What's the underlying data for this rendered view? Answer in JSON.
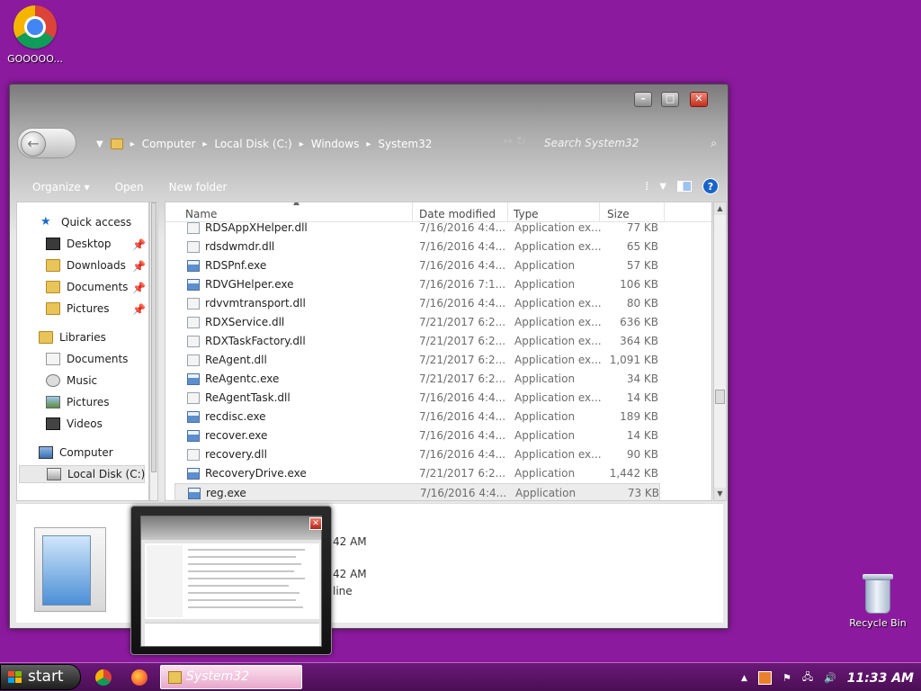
{
  "desktop": {
    "chrome_label": "GOOOOO...",
    "recycle_label": "Recycle Bin"
  },
  "window": {
    "breadcrumb": [
      "Computer",
      "Local Disk (C:)",
      "Windows",
      "System32"
    ],
    "search_placeholder": "Search System32",
    "toolbar": {
      "organize": "Organize",
      "open": "Open",
      "new_folder": "New folder"
    },
    "columns": {
      "name": "Name",
      "date": "Date modified",
      "type": "Type",
      "size": "Size"
    }
  },
  "nav": {
    "quick_access": "Quick access",
    "quick_items": [
      "Desktop",
      "Downloads",
      "Documents",
      "Pictures"
    ],
    "libraries": "Libraries",
    "library_items": [
      "Documents",
      "Music",
      "Pictures",
      "Videos"
    ],
    "computer": "Computer",
    "local_disk": "Local Disk (C:)"
  },
  "files": [
    {
      "name": "RDSAppXHelper.dll",
      "date": "7/16/2016 4:4...",
      "type": "Application ex...",
      "size": "77 KB",
      "kind": "dll"
    },
    {
      "name": "rdsdwmdr.dll",
      "date": "7/16/2016 4:4...",
      "type": "Application ex...",
      "size": "65 KB",
      "kind": "dll"
    },
    {
      "name": "RDSPnf.exe",
      "date": "7/16/2016 4:4...",
      "type": "Application",
      "size": "57 KB",
      "kind": "exe"
    },
    {
      "name": "RDVGHelper.exe",
      "date": "7/16/2016 7:1...",
      "type": "Application",
      "size": "106 KB",
      "kind": "exe"
    },
    {
      "name": "rdvvmtransport.dll",
      "date": "7/16/2016 4:4...",
      "type": "Application ex...",
      "size": "80 KB",
      "kind": "dll"
    },
    {
      "name": "RDXService.dll",
      "date": "7/21/2017 6:2...",
      "type": "Application ex...",
      "size": "636 KB",
      "kind": "dll"
    },
    {
      "name": "RDXTaskFactory.dll",
      "date": "7/21/2017 6:2...",
      "type": "Application ex...",
      "size": "364 KB",
      "kind": "dll"
    },
    {
      "name": "ReAgent.dll",
      "date": "7/21/2017 6:2...",
      "type": "Application ex...",
      "size": "1,091 KB",
      "kind": "dll"
    },
    {
      "name": "ReAgentc.exe",
      "date": "7/21/2017 6:2...",
      "type": "Application",
      "size": "34 KB",
      "kind": "exe"
    },
    {
      "name": "ReAgentTask.dll",
      "date": "7/16/2016 4:4...",
      "type": "Application ex...",
      "size": "14 KB",
      "kind": "dll"
    },
    {
      "name": "recdisc.exe",
      "date": "7/16/2016 4:4...",
      "type": "Application",
      "size": "189 KB",
      "kind": "exe"
    },
    {
      "name": "recover.exe",
      "date": "7/16/2016 4:4...",
      "type": "Application",
      "size": "14 KB",
      "kind": "exe"
    },
    {
      "name": "recovery.dll",
      "date": "7/16/2016 4:4...",
      "type": "Application ex...",
      "size": "90 KB",
      "kind": "dll"
    },
    {
      "name": "RecoveryDrive.exe",
      "date": "7/21/2017 6:2...",
      "type": "Application",
      "size": "1,442 KB",
      "kind": "exe"
    },
    {
      "name": "reg.exe",
      "date": "7/16/2016 4:4...",
      "type": "Application",
      "size": "73 KB",
      "kind": "exe",
      "selected": true
    }
  ],
  "details": {
    "line1": "42 AM",
    "line2": "42 AM",
    "line3": "line"
  },
  "taskbar": {
    "start_label": "start",
    "active_window": "System32",
    "clock": "11:33 AM"
  },
  "colors": {
    "desktop": "#8c1a9f",
    "taskbar": "#5a1466"
  }
}
